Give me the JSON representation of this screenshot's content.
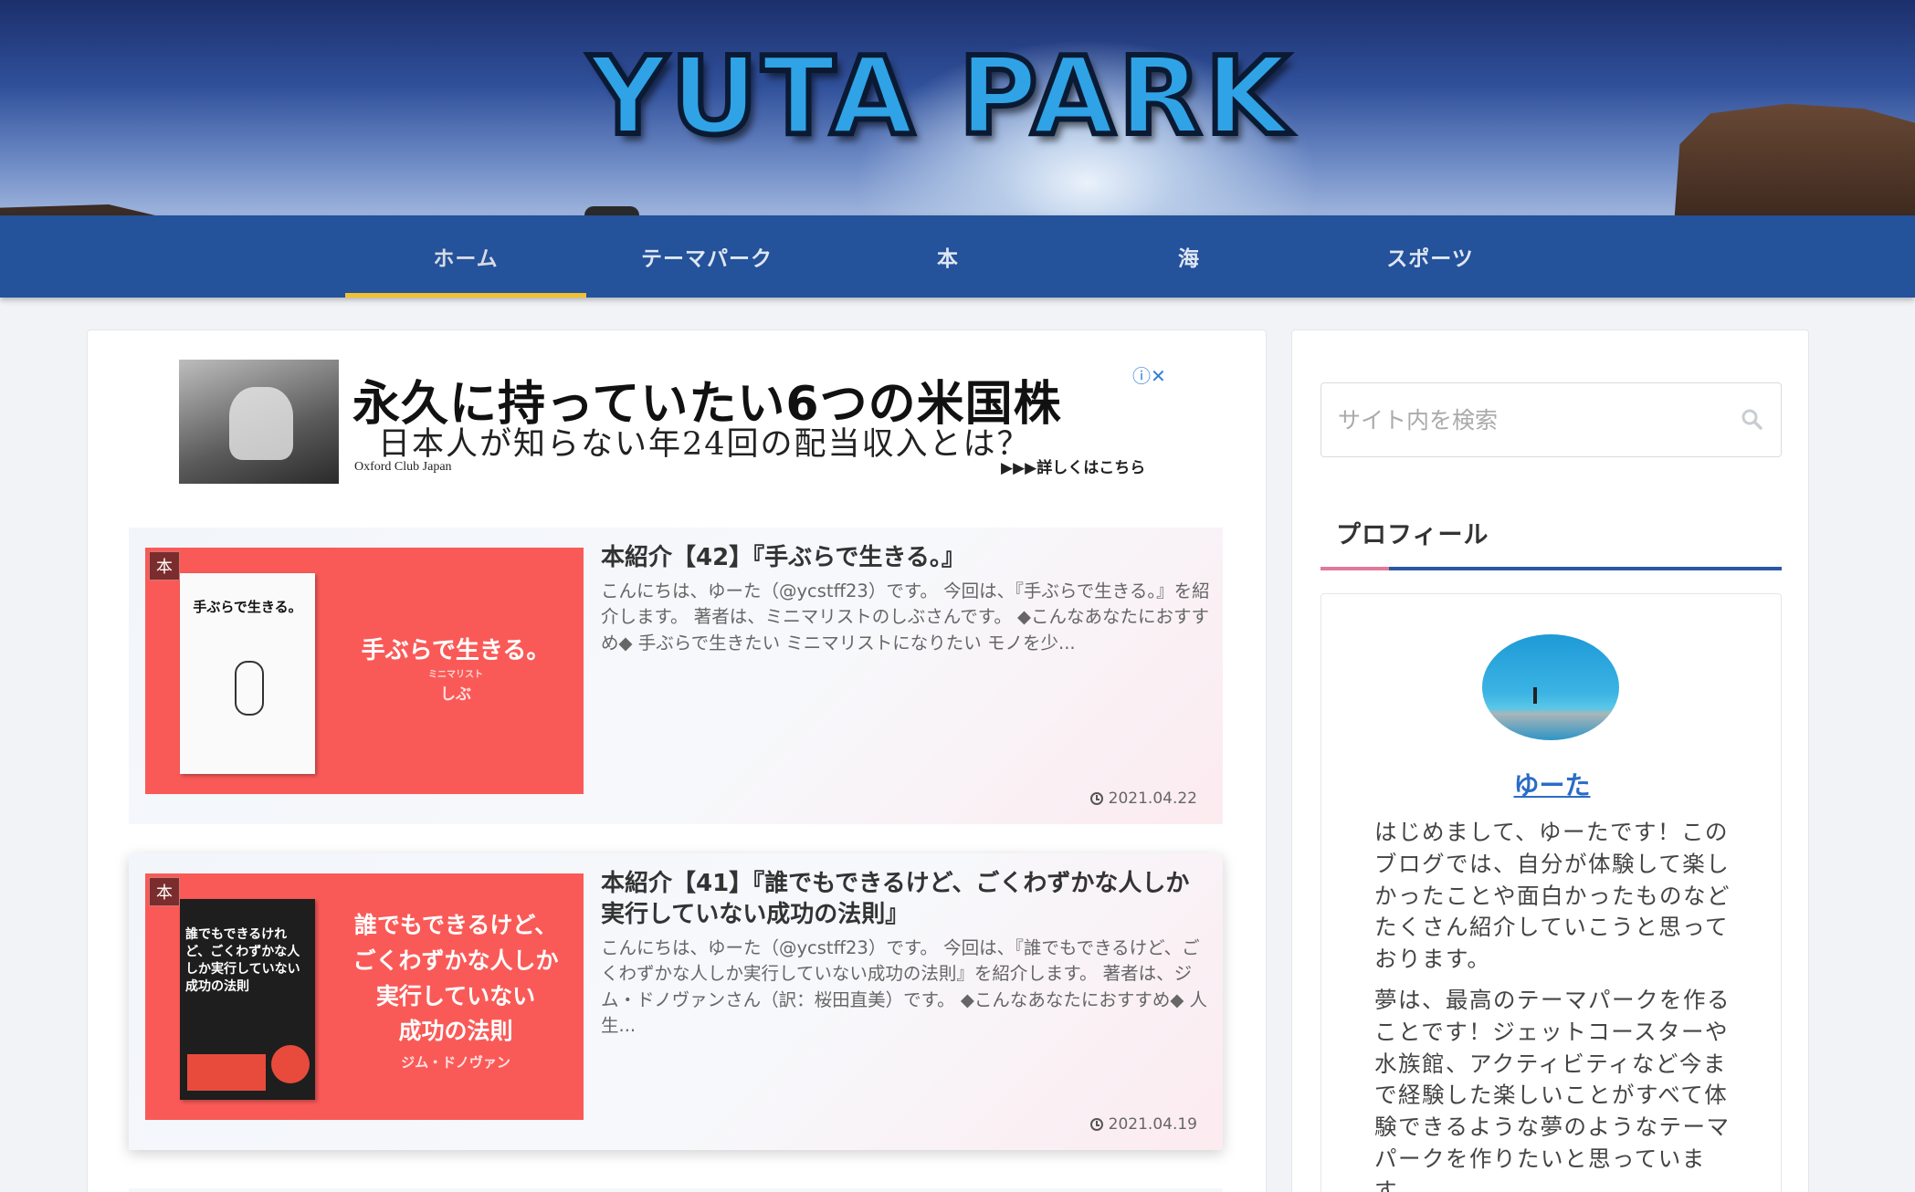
{
  "header": {
    "logo": "YUTA PARK"
  },
  "nav": {
    "items": [
      {
        "label": "ホーム"
      },
      {
        "label": "テーマパーク"
      },
      {
        "label": "本"
      },
      {
        "label": "海"
      },
      {
        "label": "スポーツ"
      }
    ]
  },
  "ad": {
    "title": "永久に持っていたい6つの米国株",
    "subtitle": "日本人が知らない年24回の配当収入とは？",
    "brand": "Oxford Club Japan",
    "cta": "▶▶▶詳しくはこちら",
    "icons": "ⓘ✕"
  },
  "posts": [
    {
      "category": "本",
      "thumb_text": "手ぶらで生きる。",
      "thumb_subtext": "ミニマリスト",
      "thumb_author": "しぶ",
      "book_title": "手ぶらで生きる。",
      "title": "本紹介【42】『手ぶらで生きる。』",
      "snippet": "こんにちは、ゆーた（@ycstff23）です。 今回は、『手ぶらで生きる。』を紹介します。 著者は、ミニマリストのしぶさんです。 ◆こんなあなたにおすすめ◆ 手ぶらで生きたい ミニマリストになりたい モノを少...",
      "date": "2021.04.22"
    },
    {
      "category": "本",
      "thumb_lines": [
        "誰でもできるけど、",
        "ごくわずかな人しか",
        "実行していない",
        "成功の法則"
      ],
      "thumb_author": "ジム・ドノヴァン",
      "book_title": "誰でもできるけれど、ごくわずかな人しか実行していない成功の法則",
      "title": "本紹介【41】『誰でもできるけど、ごくわずかな人しか実行していない成功の法則』",
      "snippet": "こんにちは、ゆーた（@ycstff23）です。 今回は、『誰でもできるけど、ごくわずかな人しか実行していない成功の法則』を紹介します。 著者は、ジム・ドノヴァンさん（訳：桜田直美）です。 ◆こんなあなたにおすすめ◆ 人生...",
      "date": "2021.04.19"
    }
  ],
  "sidebar": {
    "search_placeholder": "サイト内を検索",
    "profile_title": "プロフィール",
    "profile_name": "ゆーた",
    "bio_1": "はじめまして、ゆーたです！このブログでは、自分が体験して楽しかったことや面白かったものなどたくさん紹介していこうと思っております。",
    "bio_2": "夢は、最高のテーマパークを作ることです！ジェットコースターや水族館、アクティビティなど今まで経験した楽しいことがすべて体験できるような夢のようなテーマパークを作りたいと思っています。"
  },
  "colors": {
    "nav": "#24529b",
    "nav_active_underline": "#f2c12e",
    "thumb_bg": "#fa5a57",
    "link": "#2a6cc7"
  }
}
